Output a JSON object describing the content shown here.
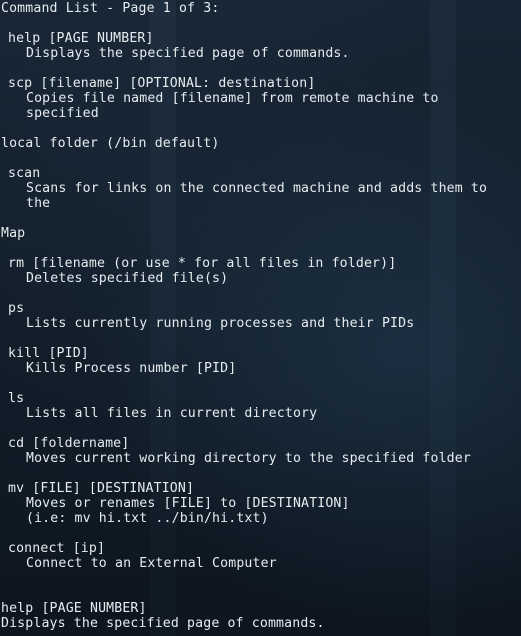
{
  "terminal": {
    "header": "Command List - Page 1 of 3:",
    "commands": [
      {
        "name": "help [PAGE NUMBER]",
        "desc": "Displays the specified page of commands."
      },
      {
        "name": "scp [filename] [OPTIONAL: destination]",
        "desc": "Copies file named [filename] from remote machine to",
        "desc2": "specified"
      },
      {
        "name": "scan",
        "desc": "Scans for links on the connected machine and adds them to",
        "desc2": "the"
      },
      {
        "name": "rm [filename (or use * for all files in folder)]",
        "desc": "Deletes specified file(s)"
      },
      {
        "name": "ps",
        "desc": "Lists currently running processes and their PIDs"
      },
      {
        "name": "kill [PID]",
        "desc": "Kills Process number [PID]"
      },
      {
        "name": "ls",
        "desc": "Lists all files in current directory"
      },
      {
        "name": "cd [foldername]",
        "desc": "Moves current working directory to the specified folder"
      },
      {
        "name": "mv [FILE] [DESTINATION]",
        "desc": "Moves or renames [FILE] to [DESTINATION]",
        "desc2": "(i.e: mv hi.txt ../bin/hi.txt)"
      },
      {
        "name": "connect [ip]",
        "desc": "Connect to an External Computer"
      }
    ],
    "notes": {
      "scp_extra": "local folder (/bin default)",
      "scan_extra": "Map"
    },
    "footer": {
      "name": "help [PAGE NUMBER]",
      "desc": "Displays the specified page of commands."
    }
  }
}
